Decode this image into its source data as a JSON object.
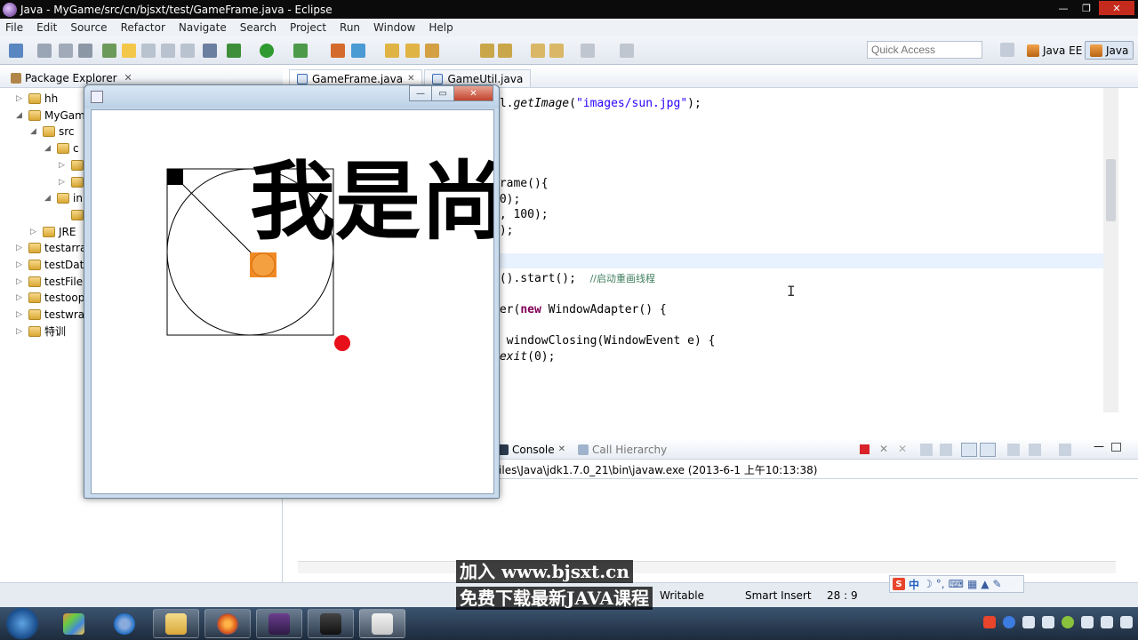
{
  "window": {
    "title": "Java - MyGame/src/cn/bjsxt/test/GameFrame.java - Eclipse"
  },
  "menu": [
    "File",
    "Edit",
    "Source",
    "Refactor",
    "Navigate",
    "Search",
    "Project",
    "Run",
    "Window",
    "Help"
  ],
  "quick_access": {
    "placeholder": "Quick Access"
  },
  "perspectives": [
    {
      "label": "Java EE",
      "active": false
    },
    {
      "label": "Java",
      "active": true
    }
  ],
  "package_explorer": {
    "tab_label": "Package Explorer",
    "items": [
      {
        "label": "hh",
        "indent": 0,
        "arrow": "▷"
      },
      {
        "label": "MyGame",
        "indent": 0,
        "arrow": "◢"
      },
      {
        "label": "src",
        "indent": 1,
        "arrow": "◢"
      },
      {
        "label": "c",
        "indent": 2,
        "arrow": "◢"
      },
      {
        "label": "",
        "indent": 3,
        "arrow": "▷"
      },
      {
        "label": "",
        "indent": 3,
        "arrow": "▷"
      },
      {
        "label": "in",
        "indent": 2,
        "arrow": "◢"
      },
      {
        "label": "",
        "indent": 3,
        "arrow": ""
      },
      {
        "label": "JRE",
        "indent": 1,
        "arrow": "▷"
      },
      {
        "label": "testarra",
        "indent": 0,
        "arrow": "▷"
      },
      {
        "label": "testDate",
        "indent": 0,
        "arrow": "▷"
      },
      {
        "label": "testFile",
        "indent": 0,
        "arrow": "▷"
      },
      {
        "label": "testoop",
        "indent": 0,
        "arrow": "▷"
      },
      {
        "label": "testwrap",
        "indent": 0,
        "arrow": "▷"
      },
      {
        "label": "特训",
        "indent": 0,
        "arrow": "▷"
      }
    ]
  },
  "editor": {
    "tabs": [
      {
        "label": "GameFrame.java",
        "active": true
      },
      {
        "label": "GameUtil.java",
        "active": false
      }
    ]
  },
  "code_lines": [
    {
      "segments": [
        {
          "t": "il.",
          "c": ""
        },
        {
          "t": "getImage",
          "c": "it"
        },
        {
          "t": "(",
          "c": ""
        },
        {
          "t": "\"images/sun.jpg\"",
          "c": "str"
        },
        {
          "t": ");",
          "c": ""
        }
      ]
    },
    {
      "segments": [
        {
          "t": "Frame(){",
          "c": ""
        }
      ]
    },
    {
      "segments": [
        {
          "t": "00);",
          "c": ""
        }
      ]
    },
    {
      "segments": [
        {
          "t": "0, 100);",
          "c": ""
        }
      ]
    },
    {
      "segments": [
        {
          "t": "e);",
          "c": ""
        }
      ]
    },
    {
      "segments": [
        {
          "t": "d().start();  ",
          "c": ""
        },
        {
          "t": "//启动重画线程",
          "c": "cm"
        }
      ]
    },
    {
      "segments": [
        {
          "t": "ner(",
          "c": ""
        },
        {
          "t": "new",
          "c": "kw"
        },
        {
          "t": " WindowAdapter() {",
          "c": ""
        }
      ]
    },
    {
      "segments": [
        {
          "t": "d",
          "c": "kw"
        },
        {
          "t": " windowClosing(WindowEvent e) {",
          "c": ""
        }
      ]
    },
    {
      "segments": [
        {
          "t": ".",
          "c": ""
        },
        {
          "t": "exit",
          "c": "it"
        },
        {
          "t": "(0);",
          "c": ""
        }
      ]
    }
  ],
  "console": {
    "tabs": [
      {
        "label": "Console",
        "active": true
      },
      {
        "label": "Call Hierarchy",
        "active": false
      }
    ],
    "launch_info": "Files\\Java\\jdk1.7.0_21\\bin\\javaw.exe (2013-6-1 上午10:13:38)"
  },
  "status": {
    "writable": "Writable",
    "insert_mode": "Smart Insert",
    "position": "28 : 9"
  },
  "game_window": {
    "big_text": "我是尚"
  },
  "watermark": {
    "line1": "加入 www.bjsxt.cn",
    "line2": "免费下载最新JAVA课程"
  },
  "ime": {
    "label": "中"
  },
  "colors": {
    "title_bar": "#0b0b0b",
    "toolbar": "#e3e8f0",
    "keyword": "#7f0055",
    "string": "#2a00ff",
    "comment": "#3f7f5f",
    "ball_orange": "#f08a24",
    "ball_red": "#e8111b"
  }
}
